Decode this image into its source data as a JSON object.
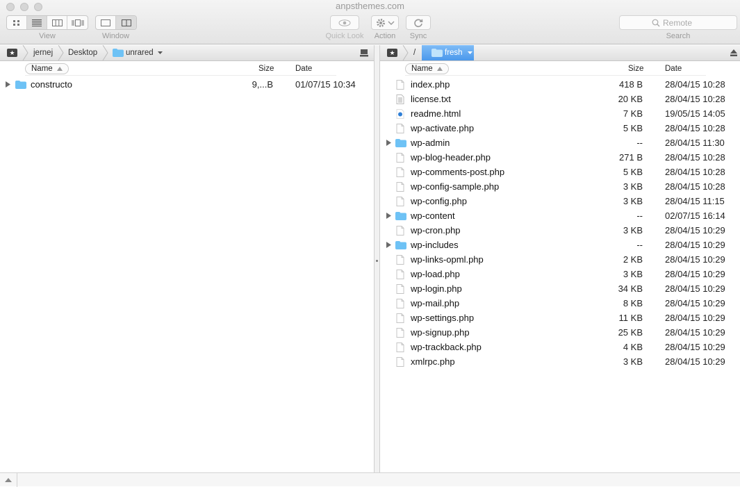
{
  "window": {
    "title": "anpsthemes.com"
  },
  "toolbar": {
    "view_label": "View",
    "window_label": "Window",
    "quicklook_label": "Quick Look",
    "action_label": "Action",
    "sync_label": "Sync",
    "search_label": "Search",
    "search_placeholder": "Remote",
    "view_mode_selected": "list",
    "window_mode_selected": "dual"
  },
  "columns": {
    "name": "Name",
    "size": "Size",
    "date": "Date"
  },
  "left_pane": {
    "breadcrumb": [
      "jernej",
      "Desktop",
      "unrared"
    ],
    "items": [
      {
        "name": "constructo",
        "size": "9,...B",
        "date": "01/07/15 10:34",
        "kind": "folder",
        "icon": "folder-icon"
      }
    ]
  },
  "right_pane": {
    "breadcrumb": [
      "/",
      "fresh"
    ],
    "items": [
      {
        "name": "index.php",
        "size": "418 B",
        "date": "28/04/15 10:28",
        "kind": "file",
        "icon": "file-icon"
      },
      {
        "name": "license.txt",
        "size": "20 KB",
        "date": "28/04/15 10:28",
        "kind": "text",
        "icon": "text-file-icon"
      },
      {
        "name": "readme.html",
        "size": "7 KB",
        "date": "19/05/15 14:05",
        "kind": "html",
        "icon": "html-file-icon"
      },
      {
        "name": "wp-activate.php",
        "size": "5 KB",
        "date": "28/04/15 10:28",
        "kind": "file",
        "icon": "file-icon"
      },
      {
        "name": "wp-admin",
        "size": "--",
        "date": "28/04/15 11:30",
        "kind": "folder",
        "icon": "folder-icon"
      },
      {
        "name": "wp-blog-header.php",
        "size": "271 B",
        "date": "28/04/15 10:28",
        "kind": "file",
        "icon": "file-icon"
      },
      {
        "name": "wp-comments-post.php",
        "size": "5 KB",
        "date": "28/04/15 10:28",
        "kind": "file",
        "icon": "file-icon"
      },
      {
        "name": "wp-config-sample.php",
        "size": "3 KB",
        "date": "28/04/15 10:28",
        "kind": "file",
        "icon": "file-icon"
      },
      {
        "name": "wp-config.php",
        "size": "3 KB",
        "date": "28/04/15 11:15",
        "kind": "file",
        "icon": "file-icon"
      },
      {
        "name": "wp-content",
        "size": "--",
        "date": "02/07/15 16:14",
        "kind": "folder",
        "icon": "folder-icon"
      },
      {
        "name": "wp-cron.php",
        "size": "3 KB",
        "date": "28/04/15 10:29",
        "kind": "file",
        "icon": "file-icon"
      },
      {
        "name": "wp-includes",
        "size": "--",
        "date": "28/04/15 10:29",
        "kind": "folder",
        "icon": "folder-icon"
      },
      {
        "name": "wp-links-opml.php",
        "size": "2 KB",
        "date": "28/04/15 10:29",
        "kind": "file",
        "icon": "file-icon"
      },
      {
        "name": "wp-load.php",
        "size": "3 KB",
        "date": "28/04/15 10:29",
        "kind": "file",
        "icon": "file-icon"
      },
      {
        "name": "wp-login.php",
        "size": "34 KB",
        "date": "28/04/15 10:29",
        "kind": "file",
        "icon": "file-icon"
      },
      {
        "name": "wp-mail.php",
        "size": "8 KB",
        "date": "28/04/15 10:29",
        "kind": "file",
        "icon": "file-icon"
      },
      {
        "name": "wp-settings.php",
        "size": "11 KB",
        "date": "28/04/15 10:29",
        "kind": "file",
        "icon": "file-icon"
      },
      {
        "name": "wp-signup.php",
        "size": "25 KB",
        "date": "28/04/15 10:29",
        "kind": "file",
        "icon": "file-icon"
      },
      {
        "name": "wp-trackback.php",
        "size": "4 KB",
        "date": "28/04/15 10:29",
        "kind": "file",
        "icon": "file-icon"
      },
      {
        "name": "xmlrpc.php",
        "size": "3 KB",
        "date": "28/04/15 10:29",
        "kind": "file",
        "icon": "file-icon"
      }
    ]
  },
  "colors": {
    "accent": "#4a98ec",
    "folder": "#6ec2f5"
  }
}
